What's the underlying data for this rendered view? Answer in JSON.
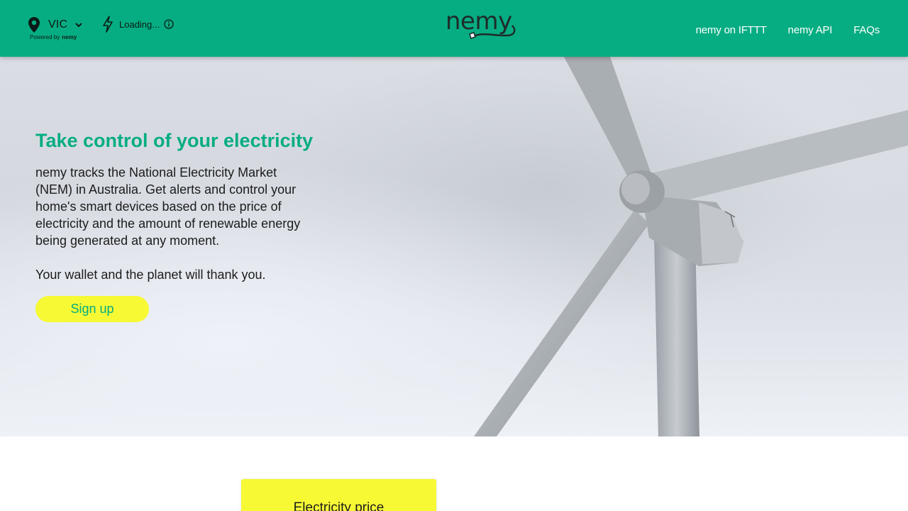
{
  "header": {
    "region": "VIC",
    "powered_by": "Powered by",
    "powered_by_brand": "nemy",
    "status": "Loading...",
    "logo_text": "nemy",
    "nav": [
      {
        "label": "nemy on IFTTT"
      },
      {
        "label": "nemy API"
      },
      {
        "label": "FAQs"
      }
    ]
  },
  "hero": {
    "title": "Take control of your electricity",
    "text": "nemy tracks the National Electricity Market (NEM) in Australia. Get alerts and control your home's smart devices based on the price of electricity and the amount of renewable energy being generated at any moment.",
    "tagline": "Your wallet and the planet will thank you.",
    "signup_label": "Sign up"
  },
  "card": {
    "title": "Electricity price"
  },
  "colors": {
    "brand_green": "#07ad82",
    "accent_yellow": "#f6f934",
    "nav_text": "#ffffff"
  },
  "icons": {
    "region": "location-pin-icon",
    "region_toggle": "chevron-down-icon",
    "status": "lightning-bolt-icon",
    "status_info": "info-icon"
  }
}
